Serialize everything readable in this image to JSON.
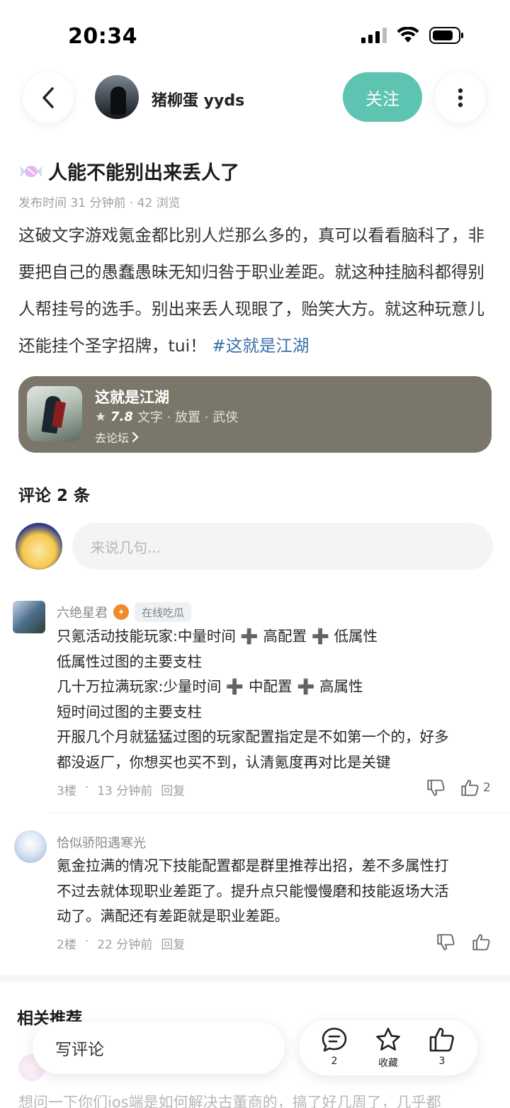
{
  "status_bar": {
    "time": "20:34"
  },
  "header": {
    "author_name": "猪柳蛋 yyds",
    "follow_label": "关注"
  },
  "post": {
    "title": "人能不能别出来丢人了",
    "meta": "发布时间 31 分钟前 · 42 浏览",
    "body": "这破文字游戏氪金都比别人烂那么多的，真可以看看脑科了，非要把自己的愚蠢愚昧无知归咎于职业差距。就这种挂脑科都得别人帮挂号的选手。别出来丢人现眼了，贻笑大方。就这种玩意儿还能挂个圣字招牌，tui！",
    "hashtag": "#这就是江湖"
  },
  "game_card": {
    "name": "这就是江湖",
    "rating": "7.8",
    "tags": "文字 · 放置 · 武侠",
    "link_label": "去论坛"
  },
  "comments": {
    "title": "评论 2 条",
    "input_placeholder": "来说几句...",
    "items": [
      {
        "user": "六绝星君",
        "tag": "在线吃瓜",
        "lines": [
          "只氪活动技能玩家:中量时间 ➕ 高配置 ➕ 低属性",
          "低属性过图的主要支柱",
          "几十万拉满玩家:少量时间 ➕ 中配置 ➕ 高属性",
          "短时间过图的主要支柱",
          "开服几个月就猛猛过图的玩家配置指定是不如第一个的，好多",
          "都没返厂，你想买也买不到，认清氪度再对比是关键"
        ],
        "floor": "3楼",
        "time": "13 分钟前",
        "reply_label": "回复",
        "likes": "2"
      },
      {
        "user": "恰似骄阳遇寒光",
        "lines": [
          "氪金拉满的情况下技能配置都是群里推荐出招，差不多属性打",
          "不过去就体现职业差距了。提升点只能慢慢磨和技能返场大活",
          "动了。满配还有差距就是职业差距。"
        ],
        "floor": "2楼",
        "time": "22 分钟前",
        "reply_label": "回复"
      }
    ]
  },
  "related": {
    "title": "相关推荐",
    "preview_text": "想问一下你们ios端是如何解决古董商的，搞了好几周了，几乎都"
  },
  "bottom_bar": {
    "write_label": "写评论",
    "comment_count": "2",
    "favorite_label": "收藏",
    "like_count": "3"
  },
  "colors": {
    "accent": "#5ec4b2",
    "hashtag": "#3b6fa8",
    "card_bg": "#7a766a"
  }
}
